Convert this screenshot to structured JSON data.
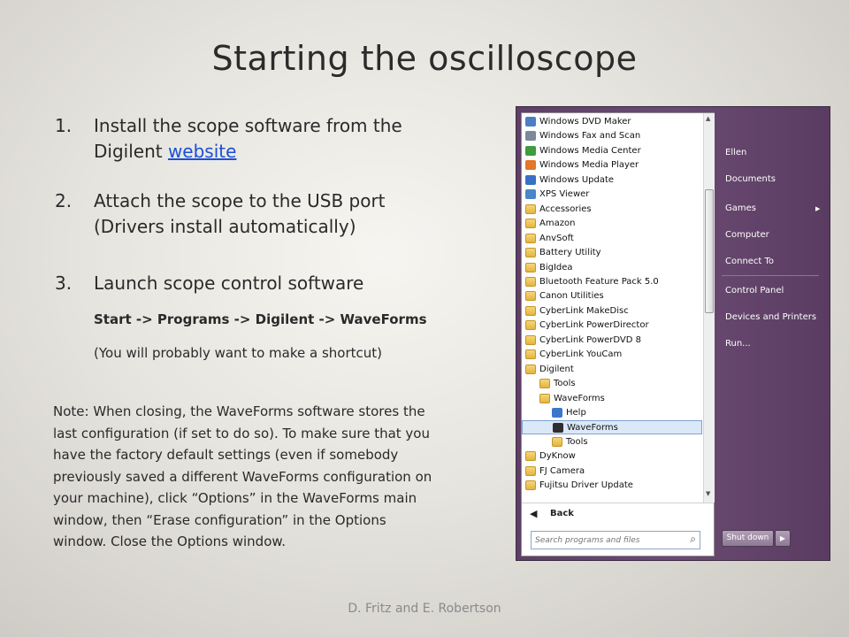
{
  "slide": {
    "title": "Starting the oscilloscope",
    "steps": [
      {
        "num": "1.",
        "line1": "Install the scope software from the",
        "line2_prefix": "Digilent ",
        "link": "website"
      },
      {
        "num": "2.",
        "line1": "Attach the scope to the USB port",
        "line2": "(Drivers install automatically)"
      },
      {
        "num": "3.",
        "line1": "Launch scope control software"
      }
    ],
    "path": "Start -> Programs -> Digilent -> WaveForms",
    "shortcut_note": "(You will probably want to make a shortcut)",
    "note_lines": [
      "Note: When closing, the WaveForms software stores the",
      "last configuration (if set to do so). To make sure that you",
      "have the factory default settings (even if somebody",
      "previously saved a different  WaveForms configuration on",
      "your machine), click “Options” in the WaveForms main",
      "window, then “Erase configuration” in the Options",
      "window. Close the Options window."
    ],
    "footer": "D. Fritz and E. Robertson"
  },
  "start_menu": {
    "programs": [
      {
        "label": "Windows DVD Maker",
        "icon": "dvd-maker-icon",
        "color": "#4b7fc4",
        "indent": 0
      },
      {
        "label": "Windows Fax and Scan",
        "icon": "fax-scan-icon",
        "color": "#7a8a9a",
        "indent": 0
      },
      {
        "label": "Windows Media Center",
        "icon": "media-center-icon",
        "color": "#3f9b3f",
        "indent": 0
      },
      {
        "label": "Windows Media Player",
        "icon": "media-player-icon",
        "color": "#e2762a",
        "indent": 0
      },
      {
        "label": "Windows Update",
        "icon": "windows-update-icon",
        "color": "#3a6fc8",
        "indent": 0
      },
      {
        "label": "XPS Viewer",
        "icon": "xps-viewer-icon",
        "color": "#4a86c8",
        "indent": 0
      },
      {
        "label": "Accessories",
        "icon": "folder-icon",
        "indent": 0
      },
      {
        "label": "Amazon",
        "icon": "folder-icon",
        "indent": 0
      },
      {
        "label": "AnvSoft",
        "icon": "folder-icon",
        "indent": 0
      },
      {
        "label": "Battery Utility",
        "icon": "folder-icon",
        "indent": 0
      },
      {
        "label": "BigIdea",
        "icon": "folder-icon",
        "indent": 0
      },
      {
        "label": "Bluetooth Feature Pack 5.0",
        "icon": "folder-icon",
        "indent": 0
      },
      {
        "label": "Canon Utilities",
        "icon": "folder-icon",
        "indent": 0
      },
      {
        "label": "CyberLink MakeDisc",
        "icon": "folder-icon",
        "indent": 0
      },
      {
        "label": "CyberLink PowerDirector",
        "icon": "folder-icon",
        "indent": 0
      },
      {
        "label": "CyberLink PowerDVD 8",
        "icon": "folder-icon",
        "indent": 0
      },
      {
        "label": "CyberLink YouCam",
        "icon": "folder-icon",
        "indent": 0
      },
      {
        "label": "Digilent",
        "icon": "folder-icon",
        "indent": 0
      },
      {
        "label": "Tools",
        "icon": "folder-icon",
        "indent": 1
      },
      {
        "label": "WaveForms",
        "icon": "folder-icon",
        "indent": 1
      },
      {
        "label": "Help",
        "icon": "help-icon",
        "color": "#3b78c9",
        "indent": 2
      },
      {
        "label": "WaveForms",
        "icon": "waveforms-app-icon",
        "color": "#2f2f2f",
        "indent": 2,
        "selected": true
      },
      {
        "label": "Tools",
        "icon": "folder-icon",
        "indent": 2
      },
      {
        "label": "DyKnow",
        "icon": "folder-icon",
        "indent": 0
      },
      {
        "label": "FJ Camera",
        "icon": "folder-icon",
        "indent": 0
      },
      {
        "label": "Fujitsu Driver Update",
        "icon": "folder-icon",
        "indent": 0
      }
    ],
    "back_label": "Back",
    "search_placeholder": "Search programs and files",
    "right_items": [
      "Ellen",
      "Documents",
      "Games",
      "Computer",
      "Connect To",
      "Control Panel",
      "Devices and Printers",
      "Run..."
    ],
    "shutdown_label": "Shut down"
  }
}
